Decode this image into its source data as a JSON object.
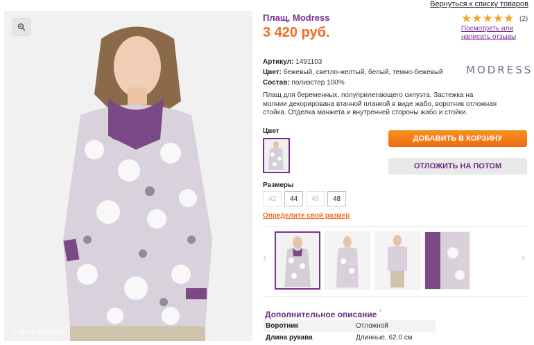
{
  "header": {
    "back_link": "Вернуться к списку товаров"
  },
  "product": {
    "title": "Плащ, Modress",
    "price": "3 420 руб.",
    "rating_count": "(2)",
    "reviews_link": "Посмотреть или написать отзывы",
    "sku_label": "Артикул:",
    "sku": "1491103",
    "color_label": "Цвет:",
    "color": "бежевый, светло-желтый, белый, темно-бежевый",
    "composition_label": "Состав:",
    "composition": "полиэстер 100%",
    "brand_logo": "MODRESS",
    "description": "Плащ для беременных, полуприлегающего силуэта. Застежка на молнии декорирована втачной планкой в виде жабо, воротник отложная стойка. Отделка манжета и внутренней стороны жабо и стойки.",
    "watermark": "© WILDBERRIES"
  },
  "color_section": {
    "label": "Цвет"
  },
  "buttons": {
    "add_to_cart": "ДОБАВИТЬ В КОРЗИНУ",
    "save_later": "ОТЛОЖИТЬ НА ПОТОМ"
  },
  "sizes": {
    "label": "Размеры",
    "options": [
      "42",
      "44",
      "46",
      "48"
    ],
    "find_size_link": "Определите свой размер"
  },
  "additional": {
    "title": "Дополнительное описание",
    "rows": [
      {
        "key": "Воротник",
        "value": "Отложной"
      },
      {
        "key": "Длина рукава",
        "value": "Длинные, 62.0 см"
      }
    ]
  },
  "colors": {
    "accent": "#7b2d8e",
    "price": "#f26c1e",
    "star": "#f5a623"
  }
}
